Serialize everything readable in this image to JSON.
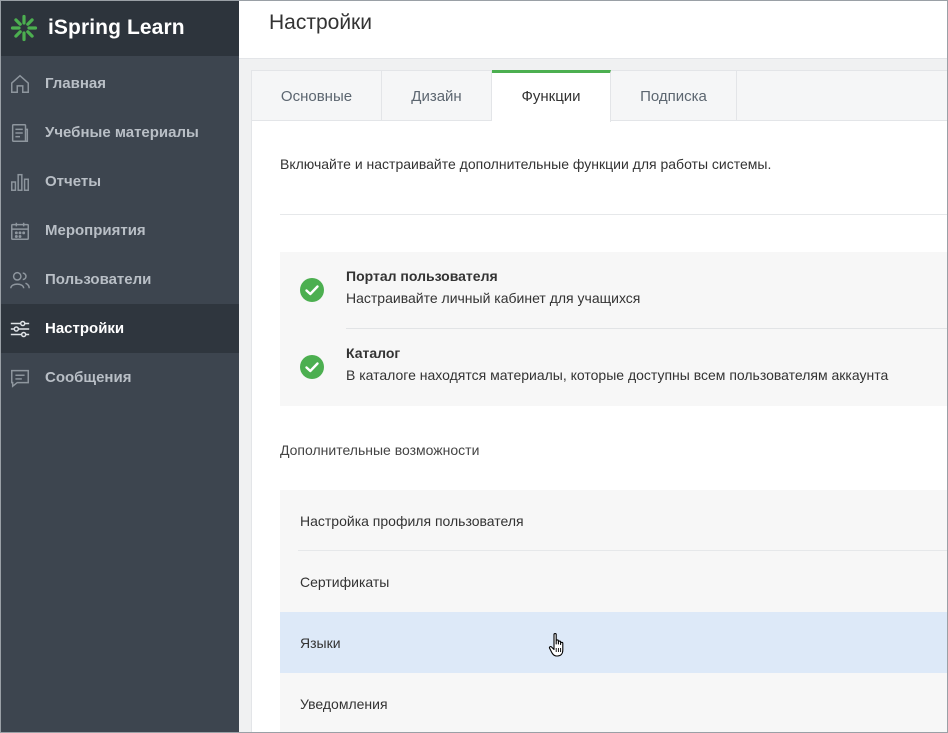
{
  "brand": {
    "name": "iSpring Learn",
    "logo_icon": "ispring-flower-icon",
    "color": "#4caf50"
  },
  "sidebar": {
    "items": [
      {
        "label": "Главная",
        "icon": "home-icon",
        "active": false
      },
      {
        "label": "Учебные материалы",
        "icon": "document-icon",
        "active": false
      },
      {
        "label": "Отчеты",
        "icon": "bar-chart-icon",
        "active": false
      },
      {
        "label": "Мероприятия",
        "icon": "calendar-icon",
        "active": false
      },
      {
        "label": "Пользователи",
        "icon": "users-icon",
        "active": false
      },
      {
        "label": "Настройки",
        "icon": "sliders-icon",
        "active": true
      },
      {
        "label": "Сообщения",
        "icon": "message-icon",
        "active": false
      }
    ]
  },
  "header": {
    "title": "Настройки"
  },
  "tabs": [
    {
      "label": "Основные",
      "active": false
    },
    {
      "label": "Дизайн",
      "active": false
    },
    {
      "label": "Функции",
      "active": true
    },
    {
      "label": "Подписка",
      "active": false
    }
  ],
  "main": {
    "intro": "Включайте и настраивайте дополнительные функции для работы системы.",
    "features": [
      {
        "title": "Портал пользователя",
        "description": "Настраивайте личный кабинет для учащихся",
        "enabled": true
      },
      {
        "title": "Каталог",
        "description": "В каталоге находятся материалы, которые доступны всем пользователям аккаунта",
        "enabled": true
      }
    ],
    "section_title": "Дополнительные возможности",
    "options": [
      {
        "label": "Настройка профиля пользователя",
        "hovered": false
      },
      {
        "label": "Сертификаты",
        "hovered": false
      },
      {
        "label": "Языки",
        "hovered": true
      },
      {
        "label": "Уведомления",
        "hovered": false
      }
    ]
  },
  "colors": {
    "sidebar_bg": "#3d454f",
    "brand_bg": "#2d343c",
    "active_tab_accent": "#4caf50",
    "hover_row": "#dde9f8",
    "check_green": "#4caf50"
  }
}
